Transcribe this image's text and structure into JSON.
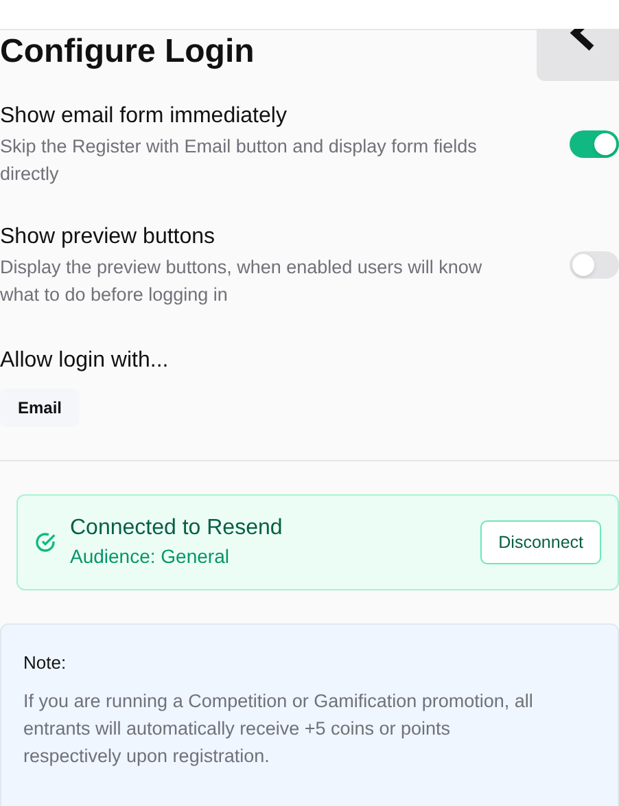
{
  "title": "Configure Login",
  "settings": [
    {
      "label": "Show email form immediately",
      "description": "Skip the Register with Email button and display form fields directly",
      "on": true
    },
    {
      "label": "Show preview buttons",
      "description": "Display the preview buttons, when enabled users will know what to do before logging in",
      "on": false
    }
  ],
  "login_methods": {
    "heading": "Allow login with...",
    "options": [
      "Email"
    ]
  },
  "connection": {
    "title": "Connected to Resend",
    "subtitle": "Audience: General",
    "button": "Disconnect"
  },
  "note": {
    "heading": "Note:",
    "text": "If you are running a Competition or Gamification promotion, all entrants will automatically receive +5 coins or points respectively upon registration."
  }
}
